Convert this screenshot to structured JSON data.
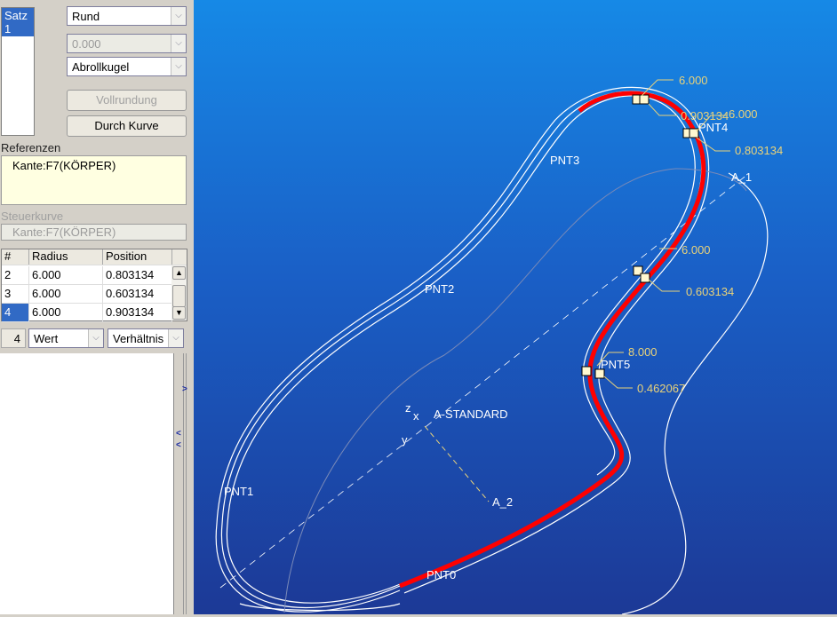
{
  "panel": {
    "sets": [
      "Satz 1"
    ],
    "type_select": "Rund",
    "value_select": "0.000",
    "method_select": "Abrollkugel",
    "btn_full_round": "Vollrundung",
    "btn_through_curve": "Durch Kurve",
    "references_label": "Referenzen",
    "references": [
      "Kante:F7(KÖRPER)"
    ],
    "guide_label": "Steuerkurve",
    "guide_value": "Kante:F7(KÖRPER)",
    "table": {
      "headers": [
        "#",
        "Radius",
        "Position"
      ],
      "rows": [
        [
          "2",
          "6.000",
          "0.803134"
        ],
        [
          "3",
          "6.000",
          "0.603134"
        ],
        [
          "4",
          "6.000",
          "0.903134"
        ]
      ]
    },
    "count": "4",
    "value_mode": "Wert",
    "position_mode": "Verhältnis"
  },
  "canvas": {
    "labels": {
      "pnt0": "PNT0",
      "pnt1": "PNT1",
      "pnt2": "PNT2",
      "pnt3": "PNT3",
      "pnt4": "PNT4",
      "pnt5": "PNT5",
      "a1": "A_1",
      "a2": "A_2",
      "csys": "A-STANDARD",
      "z": "z",
      "x": "x",
      "y": "y"
    },
    "dims": {
      "r_top": "6.000",
      "p_top": "0.903134",
      "r_pnt4": "6.000",
      "p_pnt4": "0.803134",
      "r_mid": "6.000",
      "p_mid": "0.603134",
      "r_pnt5": "8.000",
      "p_pnt5": "0.462067"
    },
    "colors": {
      "highlight": "#ff0000",
      "dim": "#e8d27a",
      "curve": "#ffffff"
    }
  }
}
